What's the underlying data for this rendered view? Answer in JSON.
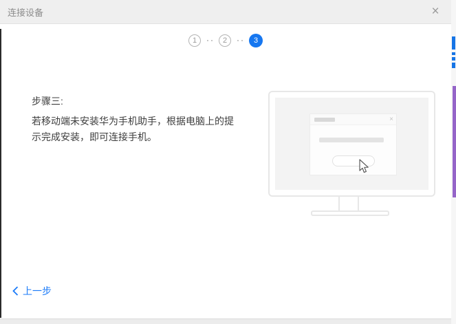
{
  "window": {
    "title": "连接设备",
    "close_glyph": "×"
  },
  "stepper": {
    "steps": [
      {
        "label": "1",
        "active": false
      },
      {
        "label": "2",
        "active": false
      },
      {
        "label": "3",
        "active": true
      }
    ]
  },
  "content": {
    "heading": "步骤三:",
    "body": "若移动端未安装华为手机助手，根据电脑上的提示完成安装，即可连接手机。"
  },
  "footer": {
    "back_label": "上一步"
  },
  "illustration": {
    "mini_close_glyph": "×"
  },
  "colors": {
    "accent": "#1677f0",
    "link": "#1a7af8",
    "titlebar_bg": "#efefef",
    "edge_blue": "#1574e6",
    "edge_purple": "#9565c8"
  }
}
